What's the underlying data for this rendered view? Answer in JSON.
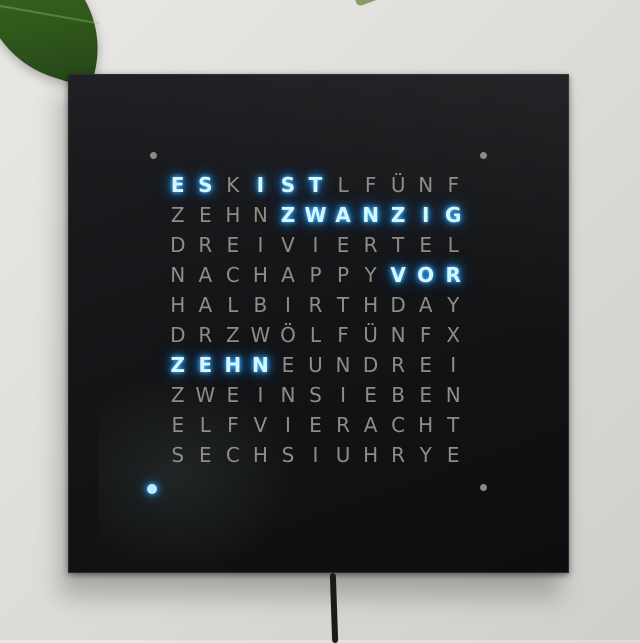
{
  "scene": {
    "subject": "word clock",
    "led_color": "#4fc6ff"
  },
  "word_clock": {
    "rows": [
      "ESKISTLFÜNF",
      "ZEHNZWANZIG",
      "DREIVIERTEL",
      "NACHAPPYVOR",
      "HALBIRTHDAY",
      "DRZWÖLFÜNFX",
      "ZEHNEUNDREI",
      "ZWEINSIEBEN",
      "ELFVIERACHT",
      "SECHSIUHRYE"
    ],
    "lit_words": [
      "ES",
      "IST",
      "ZWANZIG",
      "VOR",
      "ZEHN"
    ],
    "minute_dots_lit": 1
  }
}
